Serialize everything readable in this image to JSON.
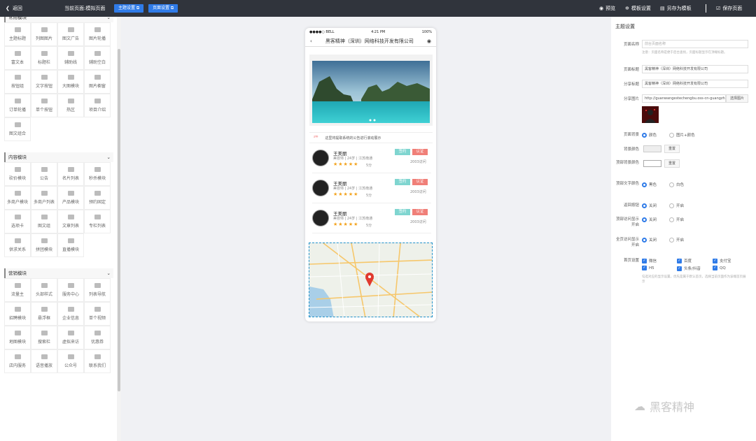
{
  "topbar": {
    "back": "返回",
    "current_label": "当前页面:",
    "current_page": "模拟页面",
    "btn_theme": "主题设置",
    "btn_page": "页面设置",
    "preview": "预览",
    "template_settings": "模板设置",
    "save_as_template": "另存为模板",
    "save_page": "保存页面"
  },
  "sidebar": {
    "groups": [
      {
        "title": "常用模块",
        "items": [
          "主题标题",
          "列图图片",
          "图文广告",
          "图片轮播",
          "富文本",
          "标题栏",
          "辅助线",
          "辅助空白",
          "按钮组",
          "文字按钮",
          "大图模块",
          "图片橱窗",
          "订单轮播",
          "单个按钮",
          "热区",
          "项目介绍",
          "图文组合"
        ]
      },
      {
        "title": "内容模块",
        "items": [
          "砍价模块",
          "公告",
          "名片列表",
          "秒杀模块",
          "多商户模块",
          "多商户列表",
          "产品模块",
          "预约固定",
          "选项卡",
          "图文组",
          "文章列表",
          "专栏列表",
          "供求关系",
          "拼团模块",
          "直播模块"
        ]
      },
      {
        "title": "营销模块",
        "items": [
          "流量主",
          "头部样式",
          "服务中心",
          "列表导航",
          "招聘模块",
          "悬浮框",
          "企业信息",
          "单个视频",
          "地图模块",
          "搜索栏",
          "虚拟来访",
          "优惠券",
          "店内服务",
          "语音播放",
          "公众号",
          "联系我们"
        ]
      }
    ]
  },
  "phone": {
    "carrier": "●●●●○ BELL",
    "time": "4:21 PM",
    "battery": "100%",
    "title": "黑客精神（深圳）网络科技开发有限公司",
    "notice": "这里将提取系统的公告进行滚动展示",
    "cards": [
      {
        "name": "王美丽",
        "meta": "美容师  |  24岁  |  江苏南通",
        "score": "5分",
        "tag1": "签约",
        "tag2": "认证",
        "sub": "2003访问"
      },
      {
        "name": "王美丽",
        "meta": "美容师  |  24岁  |  江苏南通",
        "score": "5分",
        "tag1": "签约",
        "tag2": "认证",
        "sub": "2003访问"
      },
      {
        "name": "王美丽",
        "meta": "美容师  |  24岁  |  江苏南通",
        "score": "5分",
        "tag1": "签约",
        "tag2": "认证",
        "sub": "2003访问"
      }
    ],
    "rating": 5
  },
  "settings": {
    "title": "主题设置",
    "page_name_label": "页面名称",
    "page_name_placeholder": "前台页面名称",
    "page_name_hint": "注意：页面名称是便于后台查找，页面标题显示在顶端标题。",
    "page_title_label": "页面标题",
    "page_title_value": "黑客精神（深圳）网络科技开发有限公司",
    "share_title_label": "分享标题",
    "share_title_value": "黑客精神（深圳）网络科技开发有限公司",
    "share_image_label": "分享图片",
    "share_image_value": "http://guanwangestechengbu.oss-cn-guangzhou",
    "choose_image": "选择图片",
    "bg_label": "页面背景",
    "bg_opt1": "颜色",
    "bg_opt2": "图片+颜色",
    "bgcolor_label": "背景颜色",
    "reset": "重置",
    "topbg_label": "顶部背景颜色",
    "toptext_label": "顶部文字颜色",
    "toptext_opt1": "黑色",
    "toptext_opt2": "白色",
    "backbtn_label": "返回按钮",
    "off": "关闭",
    "on": "开启",
    "toptrack_label": "顶部访问显示开启",
    "alltrack_label": "全页访问显示开启",
    "home_label": "首页设置",
    "home_items": [
      "微信",
      "百度",
      "支付宝",
      "H5",
      "头条/抖音",
      "QQ"
    ],
    "home_hint": "勾选对应的显示设置，优先是属于默认首页，选择当前页面作为该端首页展示"
  },
  "watermark": "黑客精神"
}
